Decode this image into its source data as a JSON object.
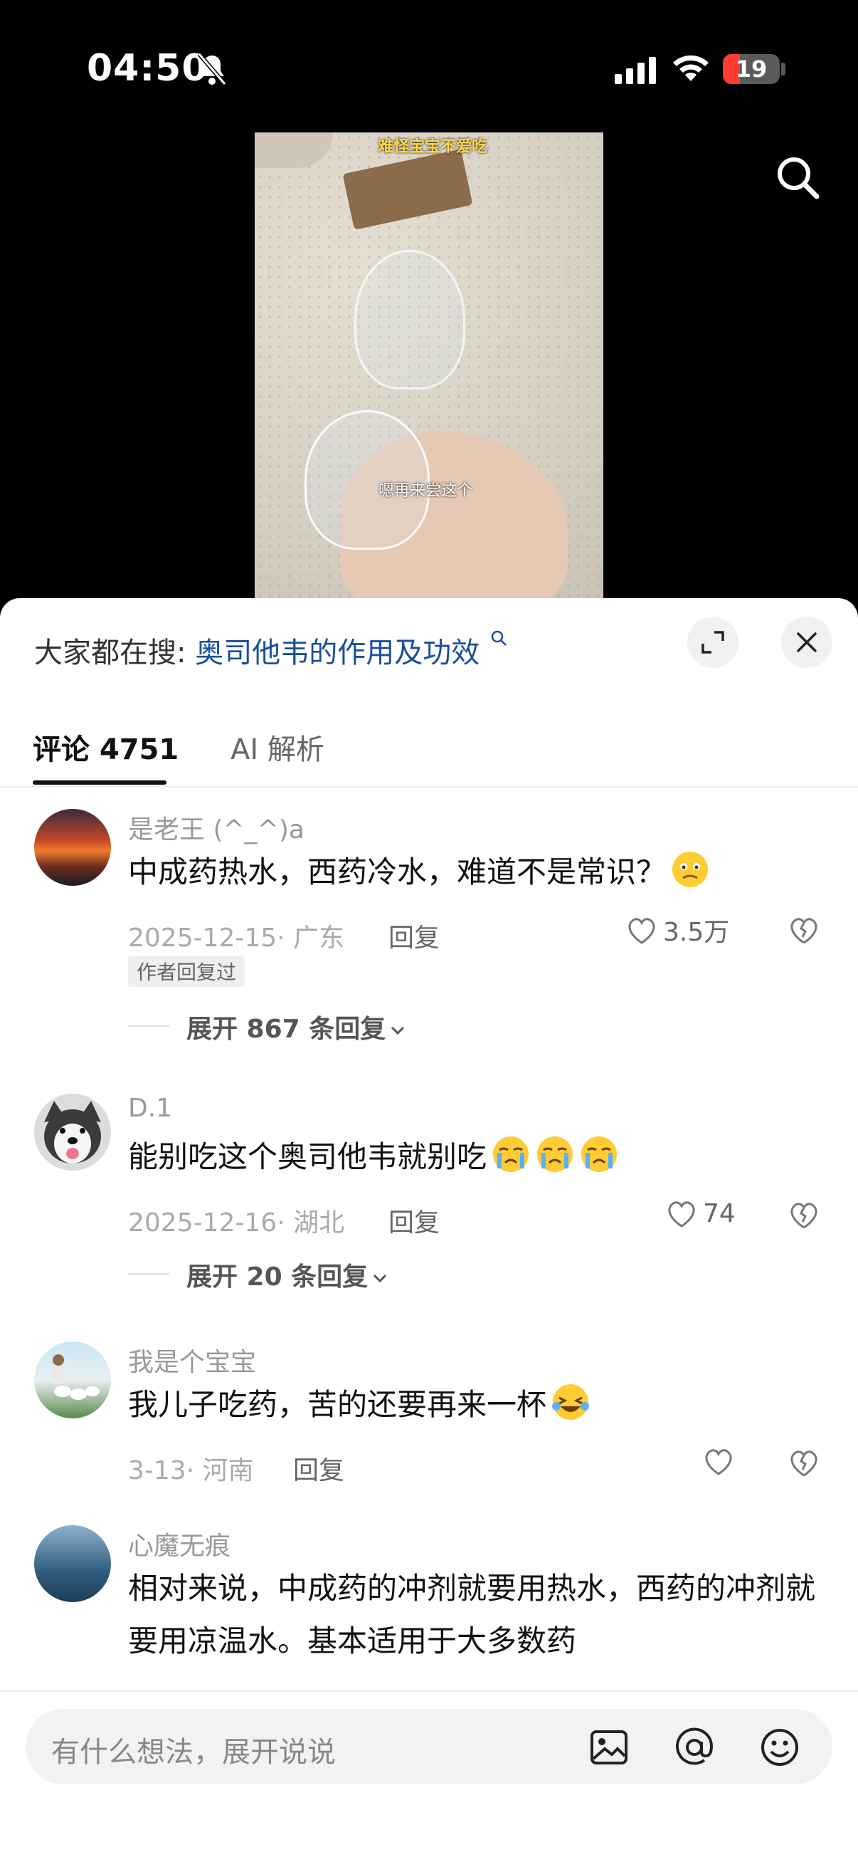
{
  "status": {
    "time": "04:50",
    "battery": "19"
  },
  "video": {
    "caption_top": "难怪宝宝不爱吃",
    "caption_mid": "嗯再来尝这个"
  },
  "sheet": {
    "hot_prefix": "大家都在搜:",
    "hot_query": "奥司他韦的作用及功效",
    "tabs": {
      "comments": "评论 4751",
      "ai": "AI 解析"
    },
    "reply_label": "回复"
  },
  "comments": [
    {
      "user": "是老王 (^_^)a",
      "text": "中成药热水，西药冷水，难道不是常识？",
      "meta": "2025-12-15· 广东",
      "likes": "3.5万",
      "badge": "作者回复过",
      "expand": "展开 867 条回复"
    },
    {
      "user": "D.1",
      "text": "能别吃这个奥司他韦就别吃",
      "meta": "2025-12-16· 湖北",
      "likes": "74",
      "expand": "展开 20 条回复"
    },
    {
      "user": "我是个宝宝",
      "text": "我儿子吃药，苦的还要再来一杯",
      "meta": "3-13· 河南",
      "likes": ""
    },
    {
      "user": "心魔无痕",
      "text": "相对来说，中成药的冲剂就要用热水，西药的冲剂就要用凉温水。基本适用于大多数药",
      "meta": "",
      "likes": ""
    }
  ],
  "input": {
    "placeholder": "有什么想法，展开说说"
  },
  "colors": {
    "link": "#1b4f9c",
    "battery_low": "#ff3b30"
  }
}
